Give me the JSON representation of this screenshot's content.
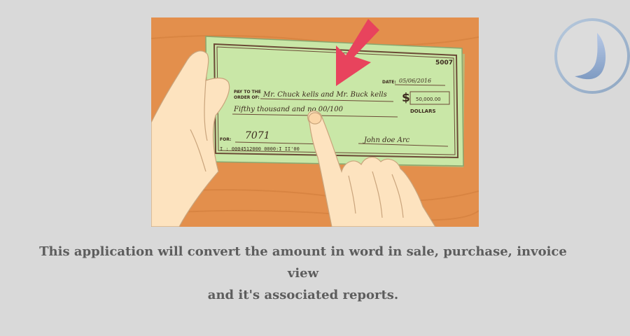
{
  "illustration": {
    "check": {
      "number": "5007",
      "date_label": "DATE:",
      "date_value": "05/06/2016",
      "pay_label_line1": "PAY TO THE",
      "pay_label_line2": "ORDER OF:",
      "payee": "Mr. Chuck kells and Mr. Buck kells",
      "currency_symbol": "$",
      "amount_numeric": "50,000.00",
      "amount_words": "Fifthy thousand and no 00/100",
      "dollars_label": "DOLLARS",
      "for_label": "FOR:",
      "memo": "7071",
      "signature": "John doe Arc",
      "micr": "I : 0004512000   0000:I   II'00"
    }
  },
  "caption": {
    "line1": "This application will convert the amount in word in sale, purchase, invoice view",
    "line2": "and it's associated reports."
  },
  "colors": {
    "background": "#d9d9d9",
    "caption_text": "#5d5d5d",
    "check_green": "#c9e7a7",
    "check_border": "#6b4a36",
    "table_wood": "#e38f4c",
    "arrow": "#e8435d",
    "skin": "#fde3bf",
    "logo_ring": "#9fb4cc"
  }
}
